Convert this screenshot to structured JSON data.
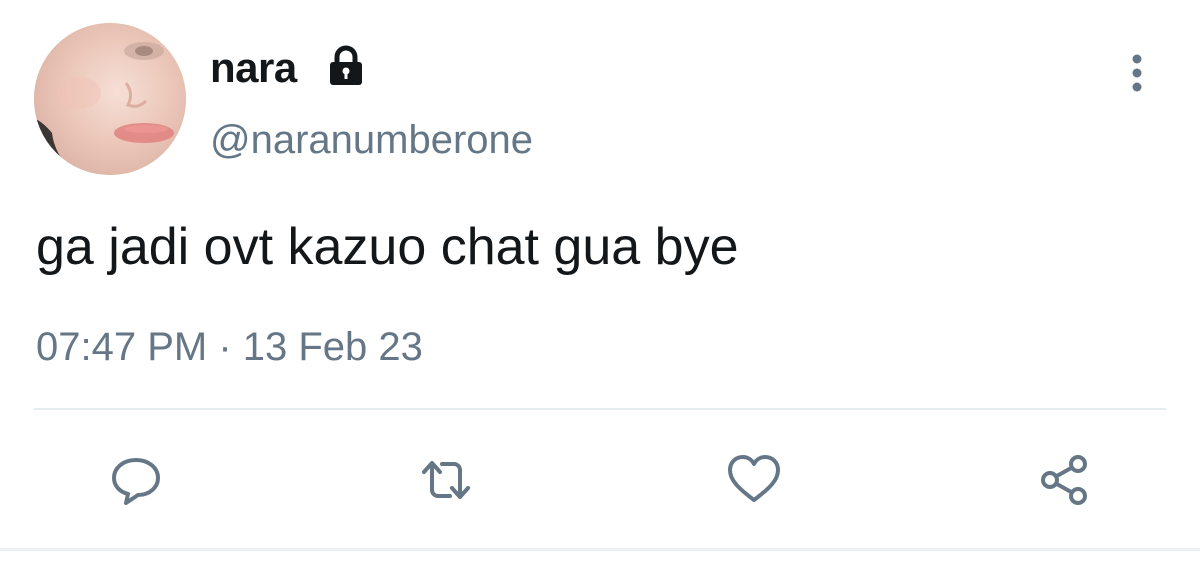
{
  "user": {
    "display_name": "nara",
    "handle": "@naranumberone",
    "protected_icon": "lock-icon"
  },
  "tweet": {
    "text": "ga jadi ovt kazuo chat gua bye",
    "timestamp": "07:47 PM · 13 Feb 23"
  },
  "menu": {
    "icon": "more-vertical-icon"
  },
  "actions": [
    {
      "name": "reply",
      "icon": "comment-icon"
    },
    {
      "name": "retweet",
      "icon": "retweet-icon"
    },
    {
      "name": "like",
      "icon": "heart-icon"
    },
    {
      "name": "share",
      "icon": "share-icon"
    }
  ],
  "colors": {
    "text_primary": "#14171a",
    "text_secondary": "#657786",
    "icon": "#657786",
    "divider": "#e6ecf0"
  }
}
